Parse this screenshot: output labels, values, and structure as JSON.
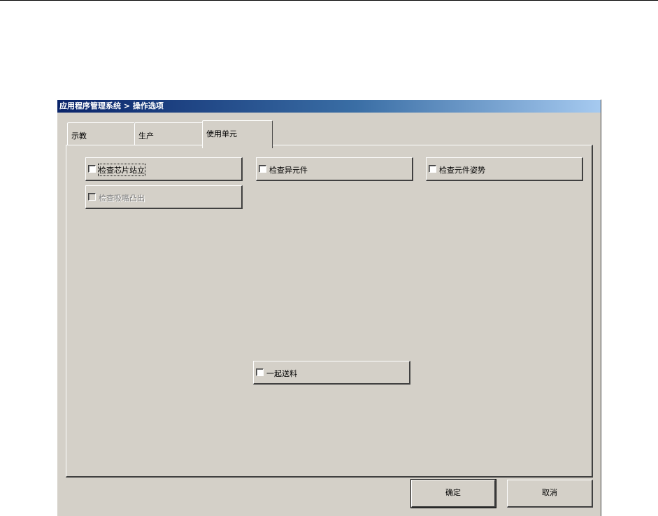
{
  "window": {
    "title": "应用程序管理系统 > 操作选项"
  },
  "tabs": [
    {
      "label": "示教",
      "active": false
    },
    {
      "label": "生产",
      "active": false
    },
    {
      "label": "使用单元",
      "active": true
    }
  ],
  "options": {
    "chip_standing": {
      "label": "检查芯片站立",
      "checked": false,
      "enabled": true
    },
    "odd_component": {
      "label": "检查异元件",
      "checked": false,
      "enabled": true
    },
    "component_posture": {
      "label": "检查元件姿势",
      "checked": false,
      "enabled": true
    },
    "nozzle_protrusion": {
      "label": "检查吸嘴凸出",
      "checked": false,
      "enabled": false
    },
    "feed_together": {
      "label": "一起送料",
      "checked": false,
      "enabled": true
    }
  },
  "buttons": {
    "ok_label": "确定",
    "cancel_label": "取消"
  }
}
